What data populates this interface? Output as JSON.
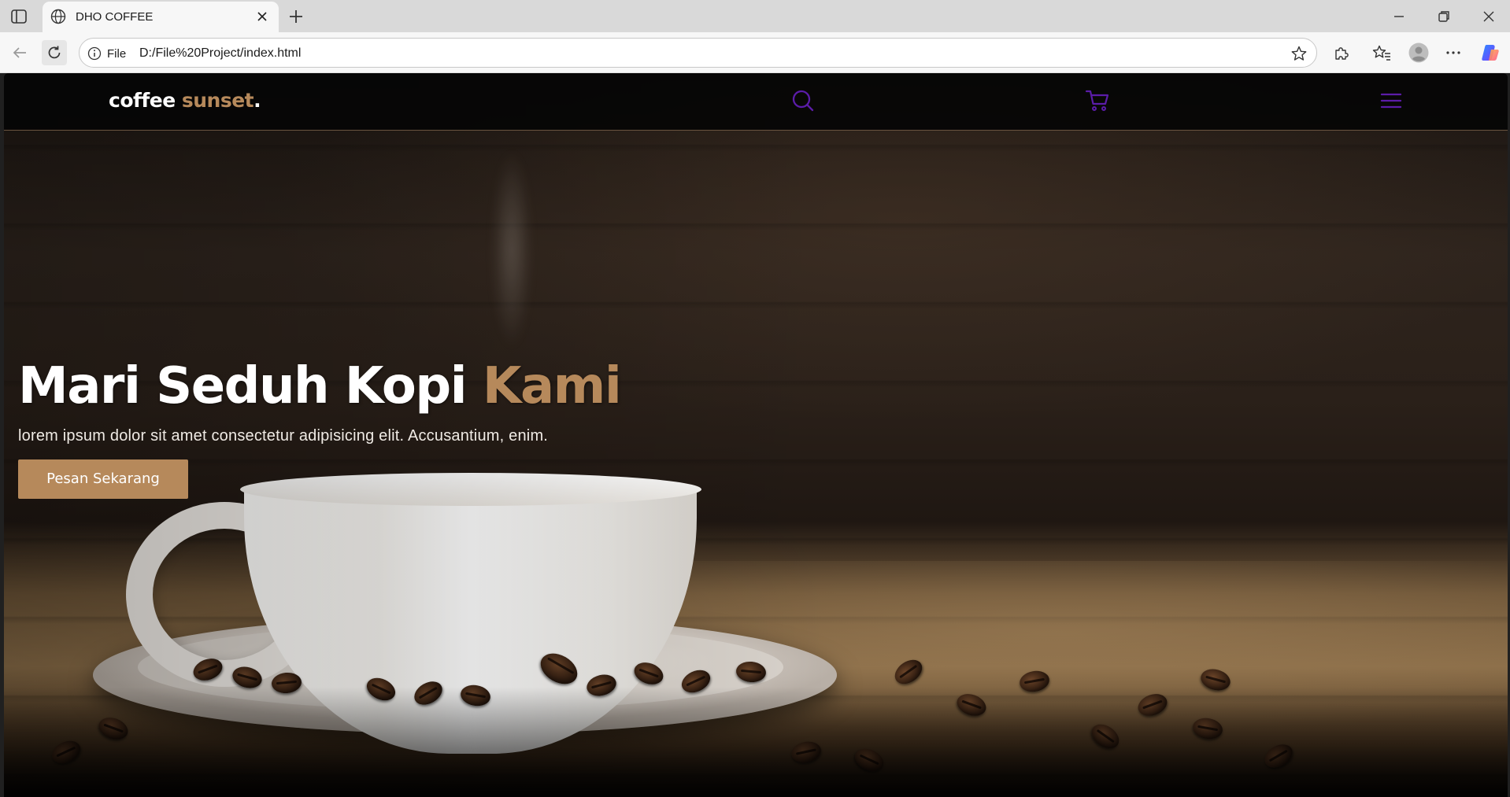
{
  "browser": {
    "tab_title": "DHO COFFEE",
    "address": {
      "scheme_label": "File",
      "url": "D:/File%20Project/index.html"
    },
    "icons": {
      "tab_actions": "tab-actions-icon",
      "tab_favicon": "globe-icon",
      "tab_close": "close-icon",
      "new_tab": "plus-icon",
      "minimize": "minimize-icon",
      "restore": "restore-icon",
      "close_window": "close-icon",
      "back": "back-arrow-icon",
      "refresh": "refresh-icon",
      "site_info": "info-icon",
      "favorite": "star-icon",
      "extensions": "puzzle-icon",
      "favorites": "favorites-icon",
      "profile": "avatar-icon",
      "more": "more-icon",
      "copilot": "copilot-icon"
    }
  },
  "site": {
    "brand": {
      "part1": "coffee ",
      "part2": "sunset",
      "part3": "."
    },
    "header_icons": [
      "search-icon",
      "cart-icon",
      "menu-icon"
    ],
    "icon_color": "#5b1ca8",
    "accent_color": "#b6895b",
    "hero": {
      "title_main": "Mari Seduh Kopi ",
      "title_accent": "Kami",
      "description": "lorem ipsum dolor sit amet consectetur adipisicing elit. Accusantium, enim.",
      "cta_label": "Pesan Sekarang"
    }
  }
}
